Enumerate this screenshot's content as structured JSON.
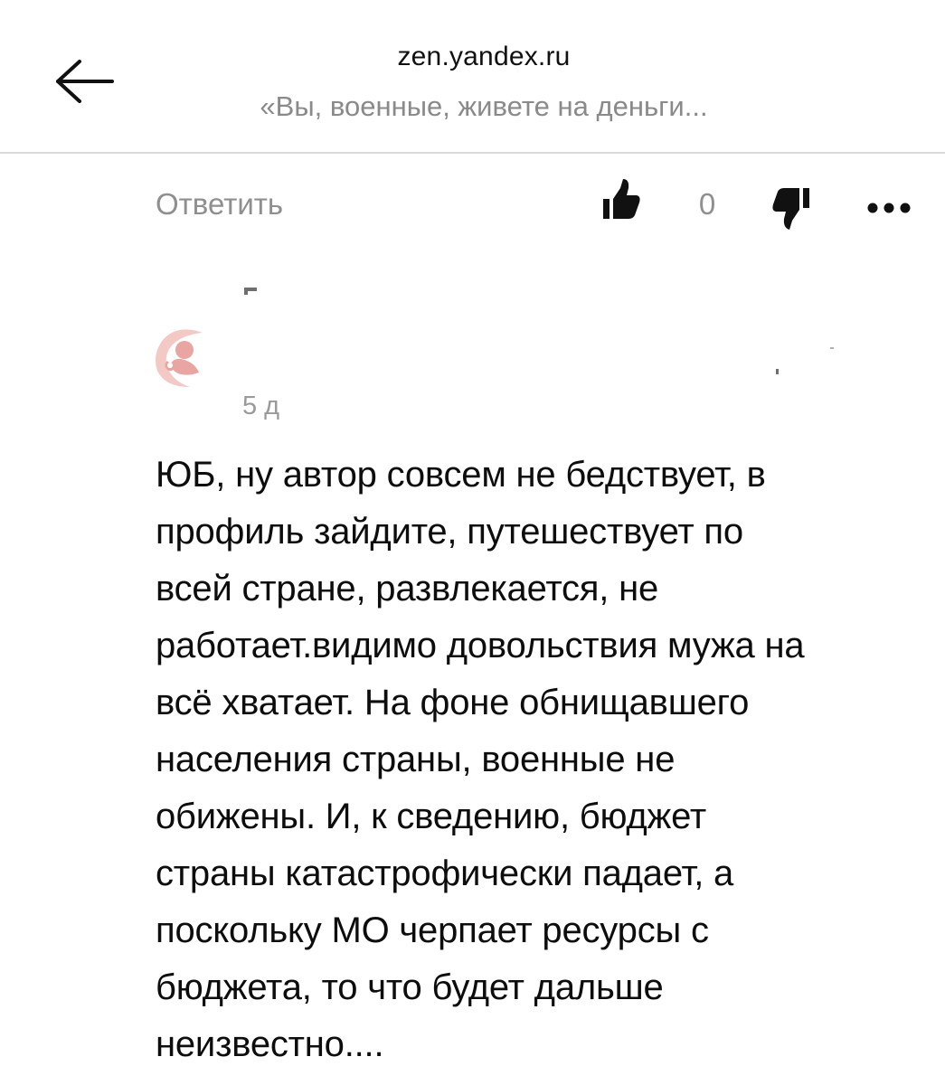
{
  "header": {
    "domain": "zen.yandex.ru",
    "title": "«Вы, военные, живете на деньги..."
  },
  "icons": {
    "back": "arrow-left-icon",
    "like": "thumbs-up-icon",
    "dislike": "thumbs-down-icon",
    "more": "more-dots-icon",
    "avatar": "avatar-icon"
  },
  "comment_actions": {
    "reply_label": "Ответить",
    "like_count": "0"
  },
  "comment": {
    "time_ago": "5 д",
    "lines": [
      "ЮБ, ну автор совсем не бедствует, в",
      "профиль зайдите, путешествует по",
      "всей стране, развлекается, не",
      "работает.видимо довольствия мужа на",
      "всё хватает. На фоне обнищавшего",
      "населения страны, военные не",
      "обижены. И, к сведению, бюджет",
      "страны катастрофически падает, а",
      "поскольку МО черпает ресурсы с",
      "бюджета, то что будет дальше",
      "неизвестно...."
    ]
  },
  "colors": {
    "muted_text": "#8f8f8f",
    "avatar_pink": "#e9a9a6",
    "divider": "#d9d9d9"
  }
}
